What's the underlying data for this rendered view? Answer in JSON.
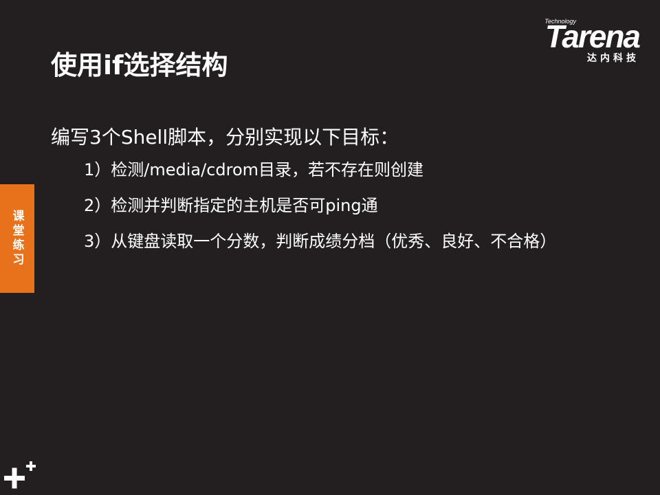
{
  "logo": {
    "technology": "Technology",
    "brand": "Tarena",
    "chinese": "达内科技"
  },
  "slide": {
    "title": "使用if选择结构",
    "lead": "编写3个Shell脚本，分别实现以下目标：",
    "items": [
      "1）检测/media/cdrom目录，若不存在则创建",
      "2）检测并判断指定的主机是否可ping通",
      "3）从键盘读取一个分数，判断成绩分档（优秀、良好、不合格）"
    ]
  },
  "side_tab": {
    "label": "课堂练习"
  },
  "colors": {
    "background": "#231f20",
    "accent": "#e8721c",
    "text": "#ffffff"
  },
  "icons": {
    "corner": "plus-mark-icon"
  }
}
